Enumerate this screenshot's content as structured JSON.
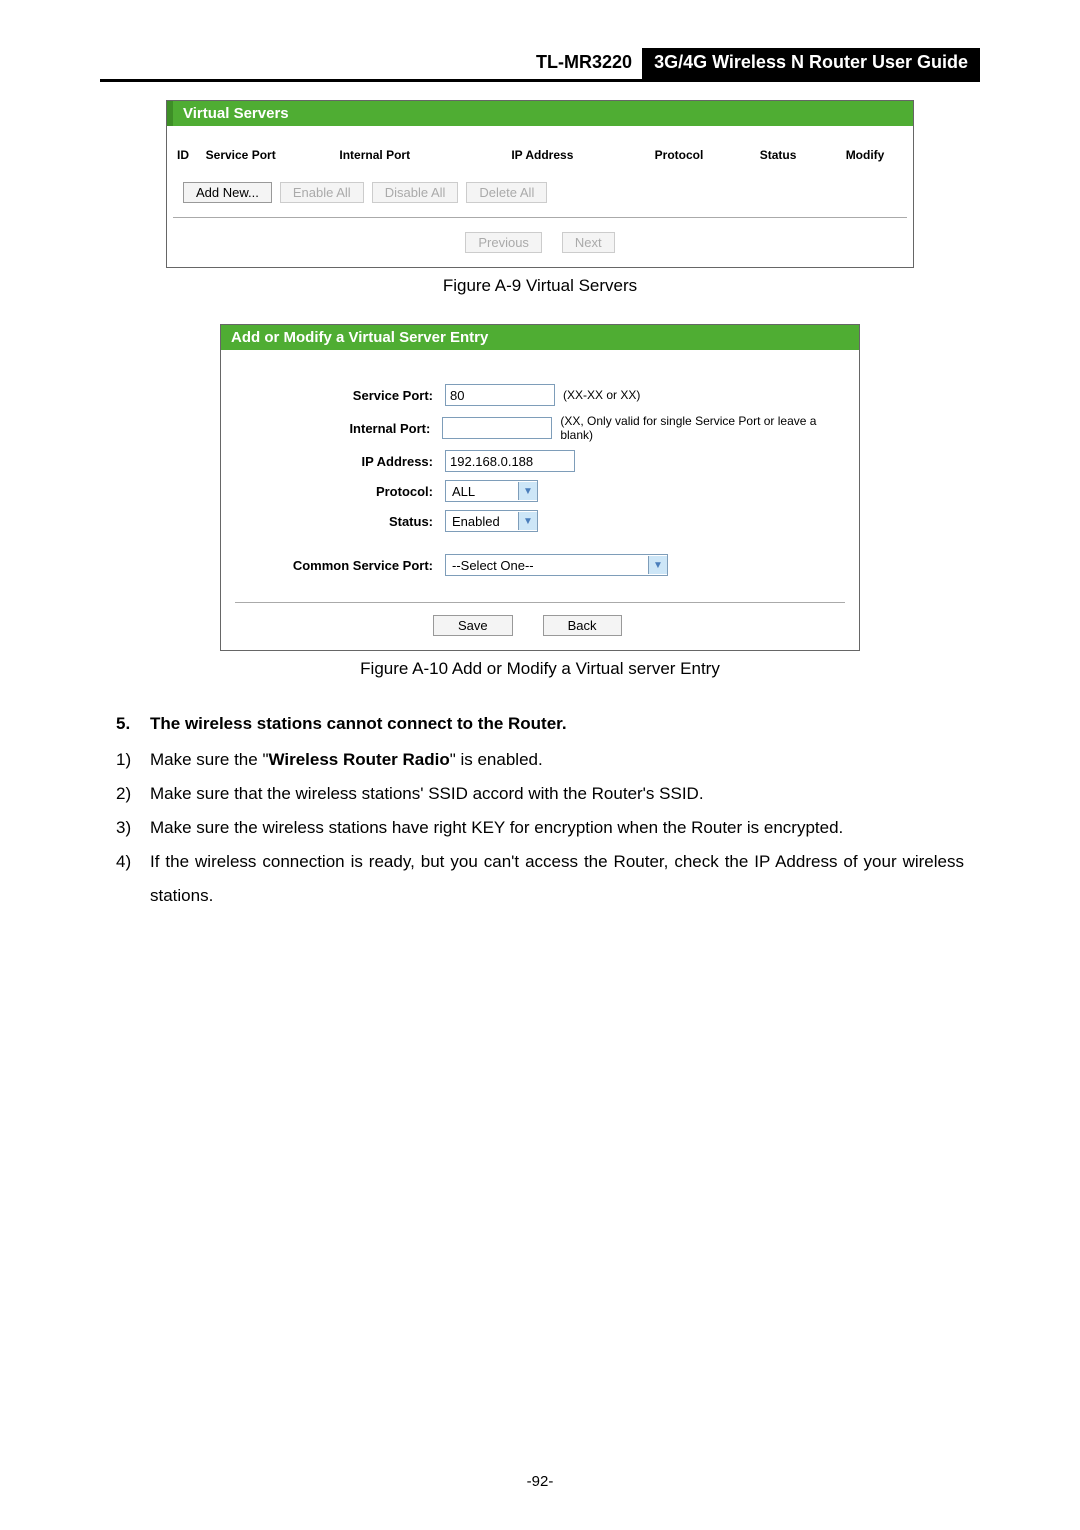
{
  "header": {
    "model": "TL-MR3220",
    "title": "3G/4G Wireless N Router User Guide"
  },
  "fig1": {
    "title": "Virtual Servers",
    "cols": {
      "id": "ID",
      "service_port": "Service Port",
      "internal_port": "Internal Port",
      "ip": "IP Address",
      "protocol": "Protocol",
      "status": "Status",
      "modify": "Modify"
    },
    "buttons": {
      "add": "Add New...",
      "enable": "Enable All",
      "disable": "Disable All",
      "delete": "Delete All",
      "prev": "Previous",
      "next": "Next"
    },
    "caption": "Figure A-9 Virtual Servers"
  },
  "fig2": {
    "title": "Add or Modify a Virtual Server Entry",
    "labels": {
      "service_port": "Service Port:",
      "internal_port": "Internal Port:",
      "ip": "IP Address:",
      "protocol": "Protocol:",
      "status": "Status:",
      "common": "Common Service Port:"
    },
    "values": {
      "service_port": "80",
      "service_port_hint": "(XX-XX or XX)",
      "internal_port_hint": "(XX, Only valid for single Service Port or leave a blank)",
      "ip": "192.168.0.188",
      "protocol": "ALL",
      "status": "Enabled",
      "common": "--Select One--"
    },
    "buttons": {
      "save": "Save",
      "back": "Back"
    },
    "caption": "Figure A-10 Add or Modify a Virtual server Entry"
  },
  "section": {
    "num": "5.",
    "title": "The wireless stations cannot connect to the Router.",
    "items": [
      {
        "n": "1)",
        "pre": "Make sure the \"",
        "bold": "Wireless Router Radio",
        "post": "\" is enabled."
      },
      {
        "n": "2)",
        "text": "Make sure that the wireless stations' SSID accord with the Router's SSID."
      },
      {
        "n": "3)",
        "text": "Make sure the wireless stations have right KEY for encryption when the Router is encrypted."
      },
      {
        "n": "4)",
        "text": "If the wireless connection is ready, but you can't access the Router, check the IP Address of your wireless stations."
      }
    ]
  },
  "page_number": "-92-"
}
